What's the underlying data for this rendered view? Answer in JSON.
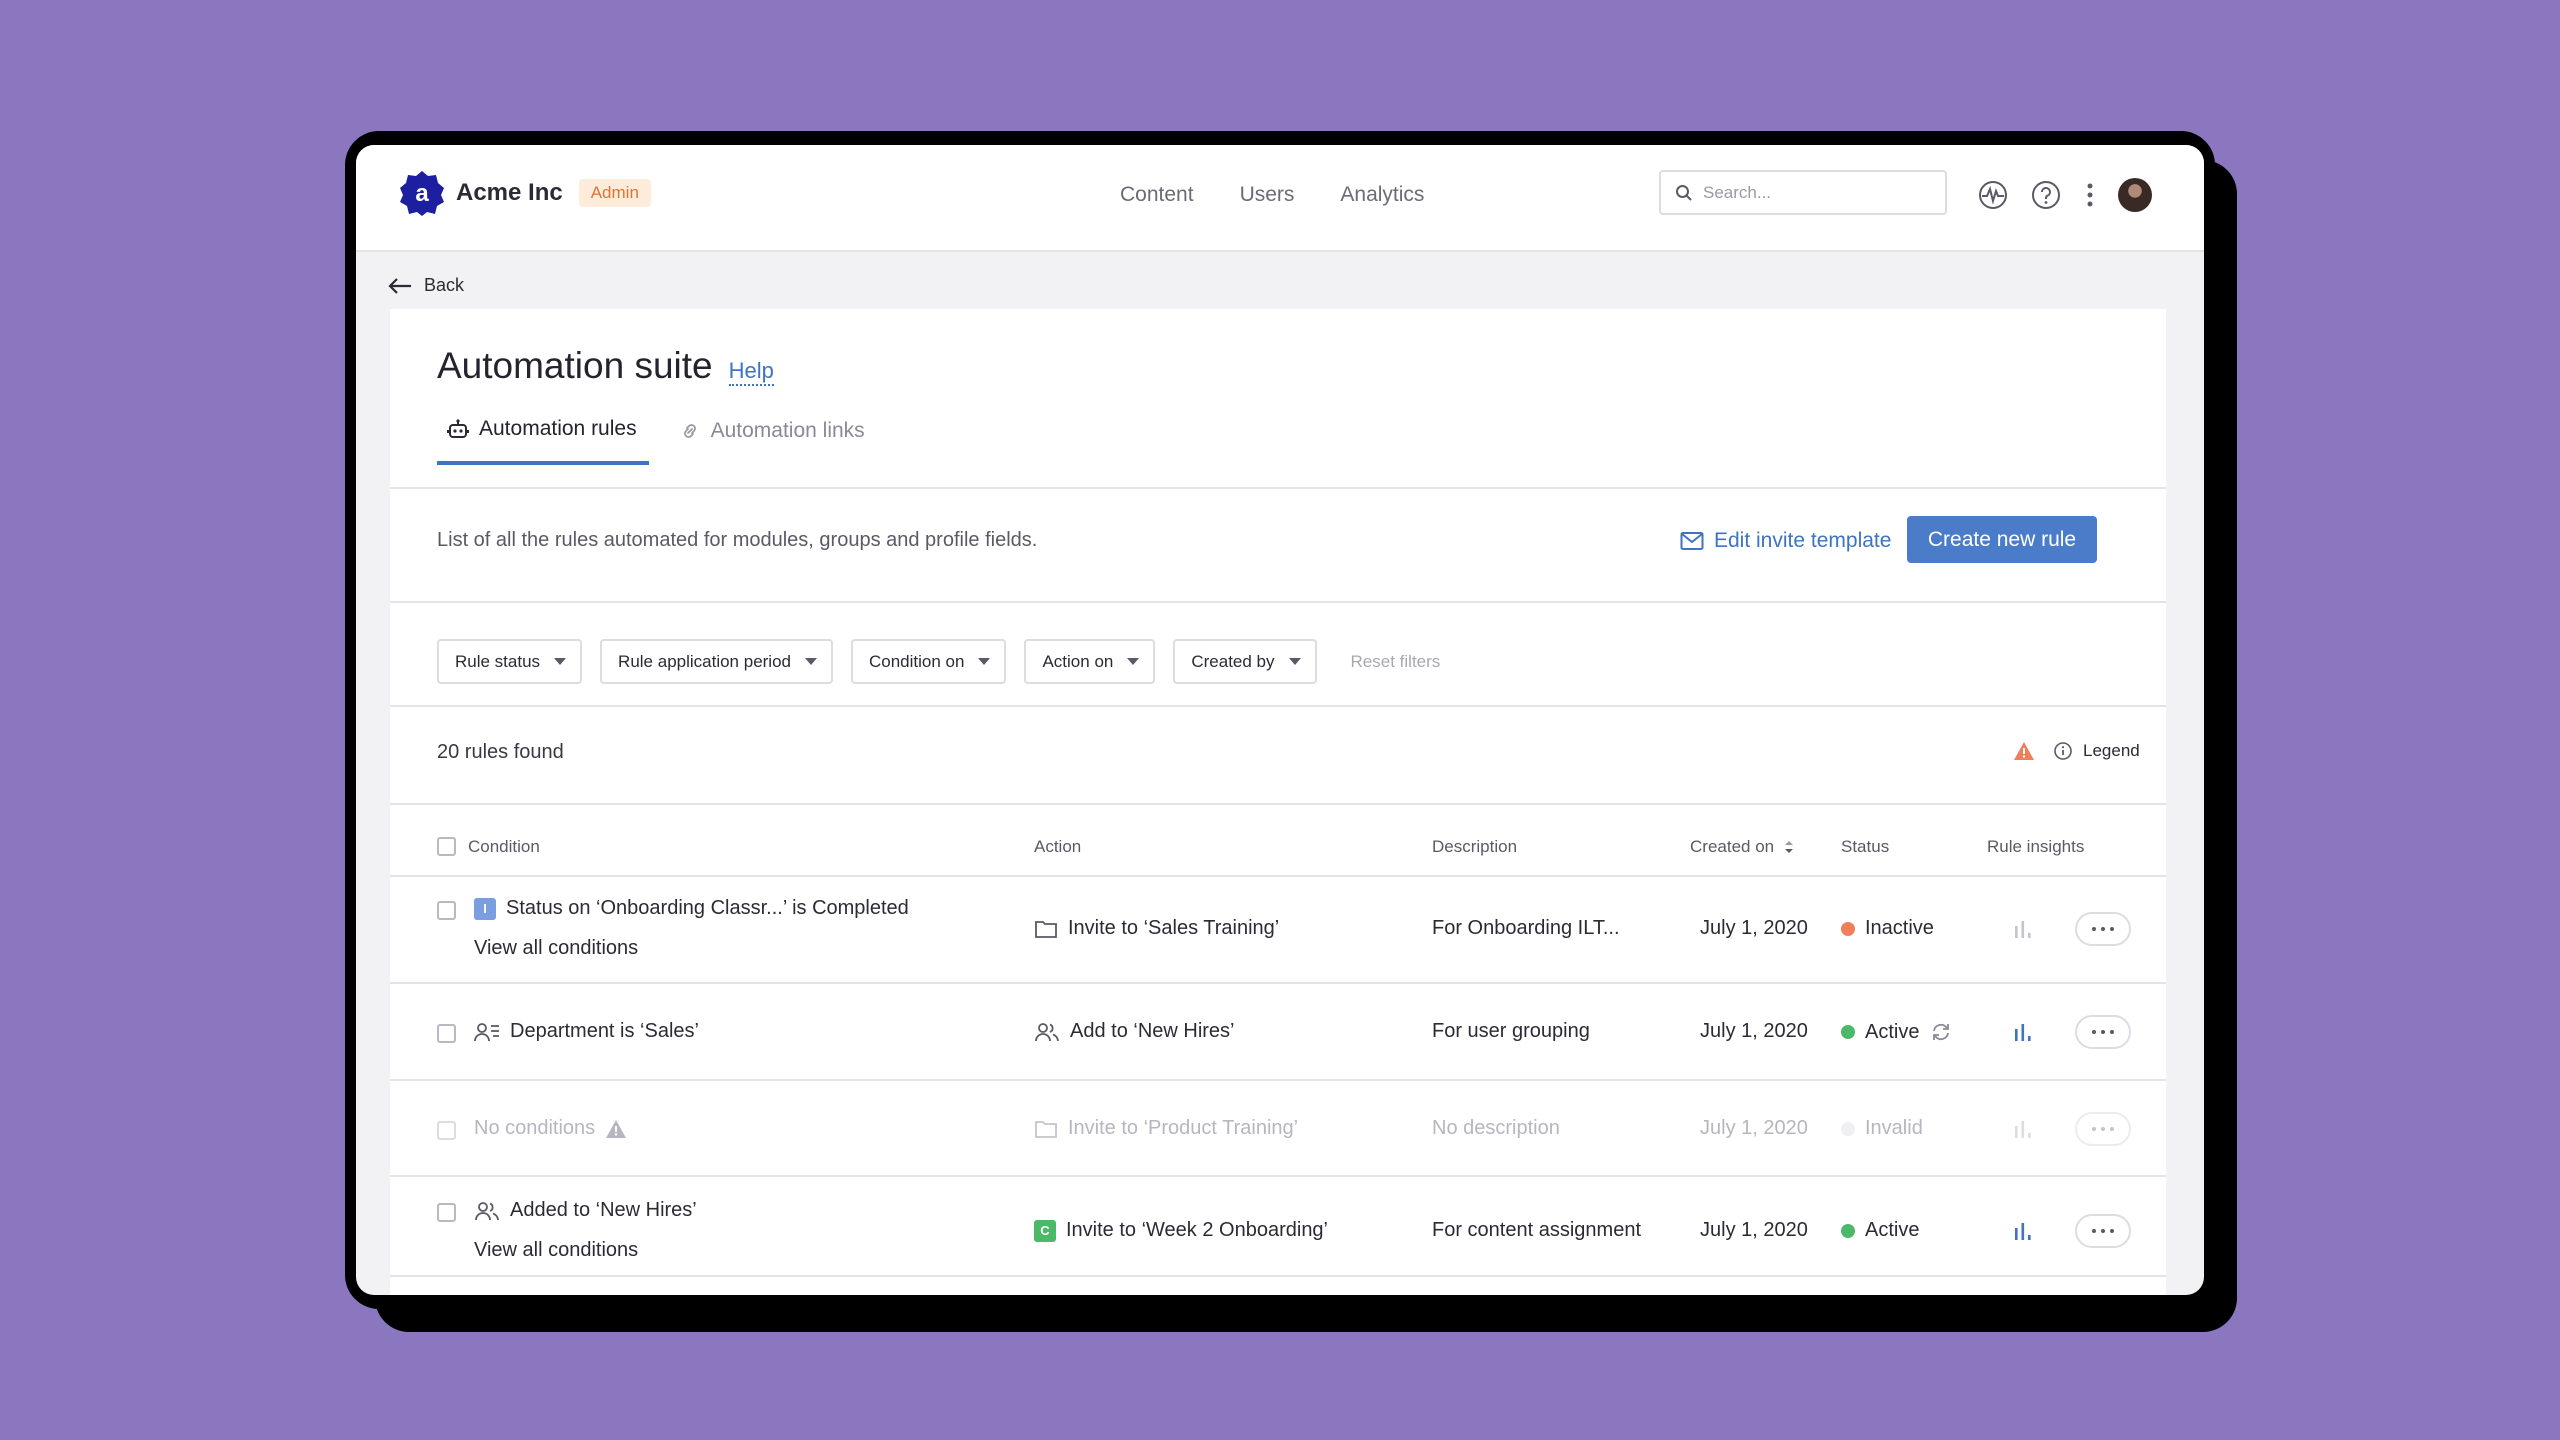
{
  "header": {
    "brand_name": "Acme Inc",
    "role_badge": "Admin",
    "nav": [
      "Content",
      "Users",
      "Analytics"
    ],
    "search_placeholder": "Search..."
  },
  "back_label": "Back",
  "page": {
    "title": "Automation suite",
    "help_label": "Help",
    "tabs": [
      {
        "label": "Automation rules",
        "active": true,
        "icon": "robot-icon"
      },
      {
        "label": "Automation links",
        "active": false,
        "icon": "link-icon"
      }
    ],
    "description": "List of all the rules automated for modules, groups and profile fields.",
    "edit_template_label": "Edit invite template",
    "create_rule_label": "Create new rule"
  },
  "filters": {
    "items": [
      "Rule status",
      "Rule application period",
      "Condition on",
      "Action on",
      "Created by"
    ],
    "reset_label": "Reset filters"
  },
  "results": {
    "count_label": "20 rules found",
    "legend_label": "Legend"
  },
  "table": {
    "columns": [
      "Condition",
      "Action",
      "Description",
      "Created on",
      "Status",
      "Rule insights"
    ],
    "rows": [
      {
        "condition": "Status on ‘Onboarding Classr...’ is Completed",
        "condition_icon": "I",
        "condition_link": "View all conditions",
        "action": "Invite to ‘Sales Training’",
        "description": "For Onboarding ILT...",
        "created_on": "July 1, 2020",
        "status": "Inactive"
      },
      {
        "condition": "Department is ‘Sales’",
        "action": "Add to ‘New Hires’",
        "description": "For user grouping",
        "created_on": "July 1, 2020",
        "status": "Active"
      },
      {
        "condition": "No conditions",
        "action": "Invite to ‘Product Training’",
        "description": "No description",
        "created_on": "July 1, 2020",
        "status": "Invalid"
      },
      {
        "condition": "Added to ‘New Hires’",
        "condition_link": "View all conditions",
        "action": "Invite to ‘Week 2 Onboarding’",
        "action_icon": "C",
        "description": "For content assignment",
        "created_on": "July 1, 2020",
        "status": "Active"
      }
    ]
  },
  "colors": {
    "accent": "#4a7cc9",
    "status_active": "#4cb86a",
    "status_inactive": "#ee7f5a",
    "warning": "#ee7f5a",
    "background": "#8b77c0"
  }
}
